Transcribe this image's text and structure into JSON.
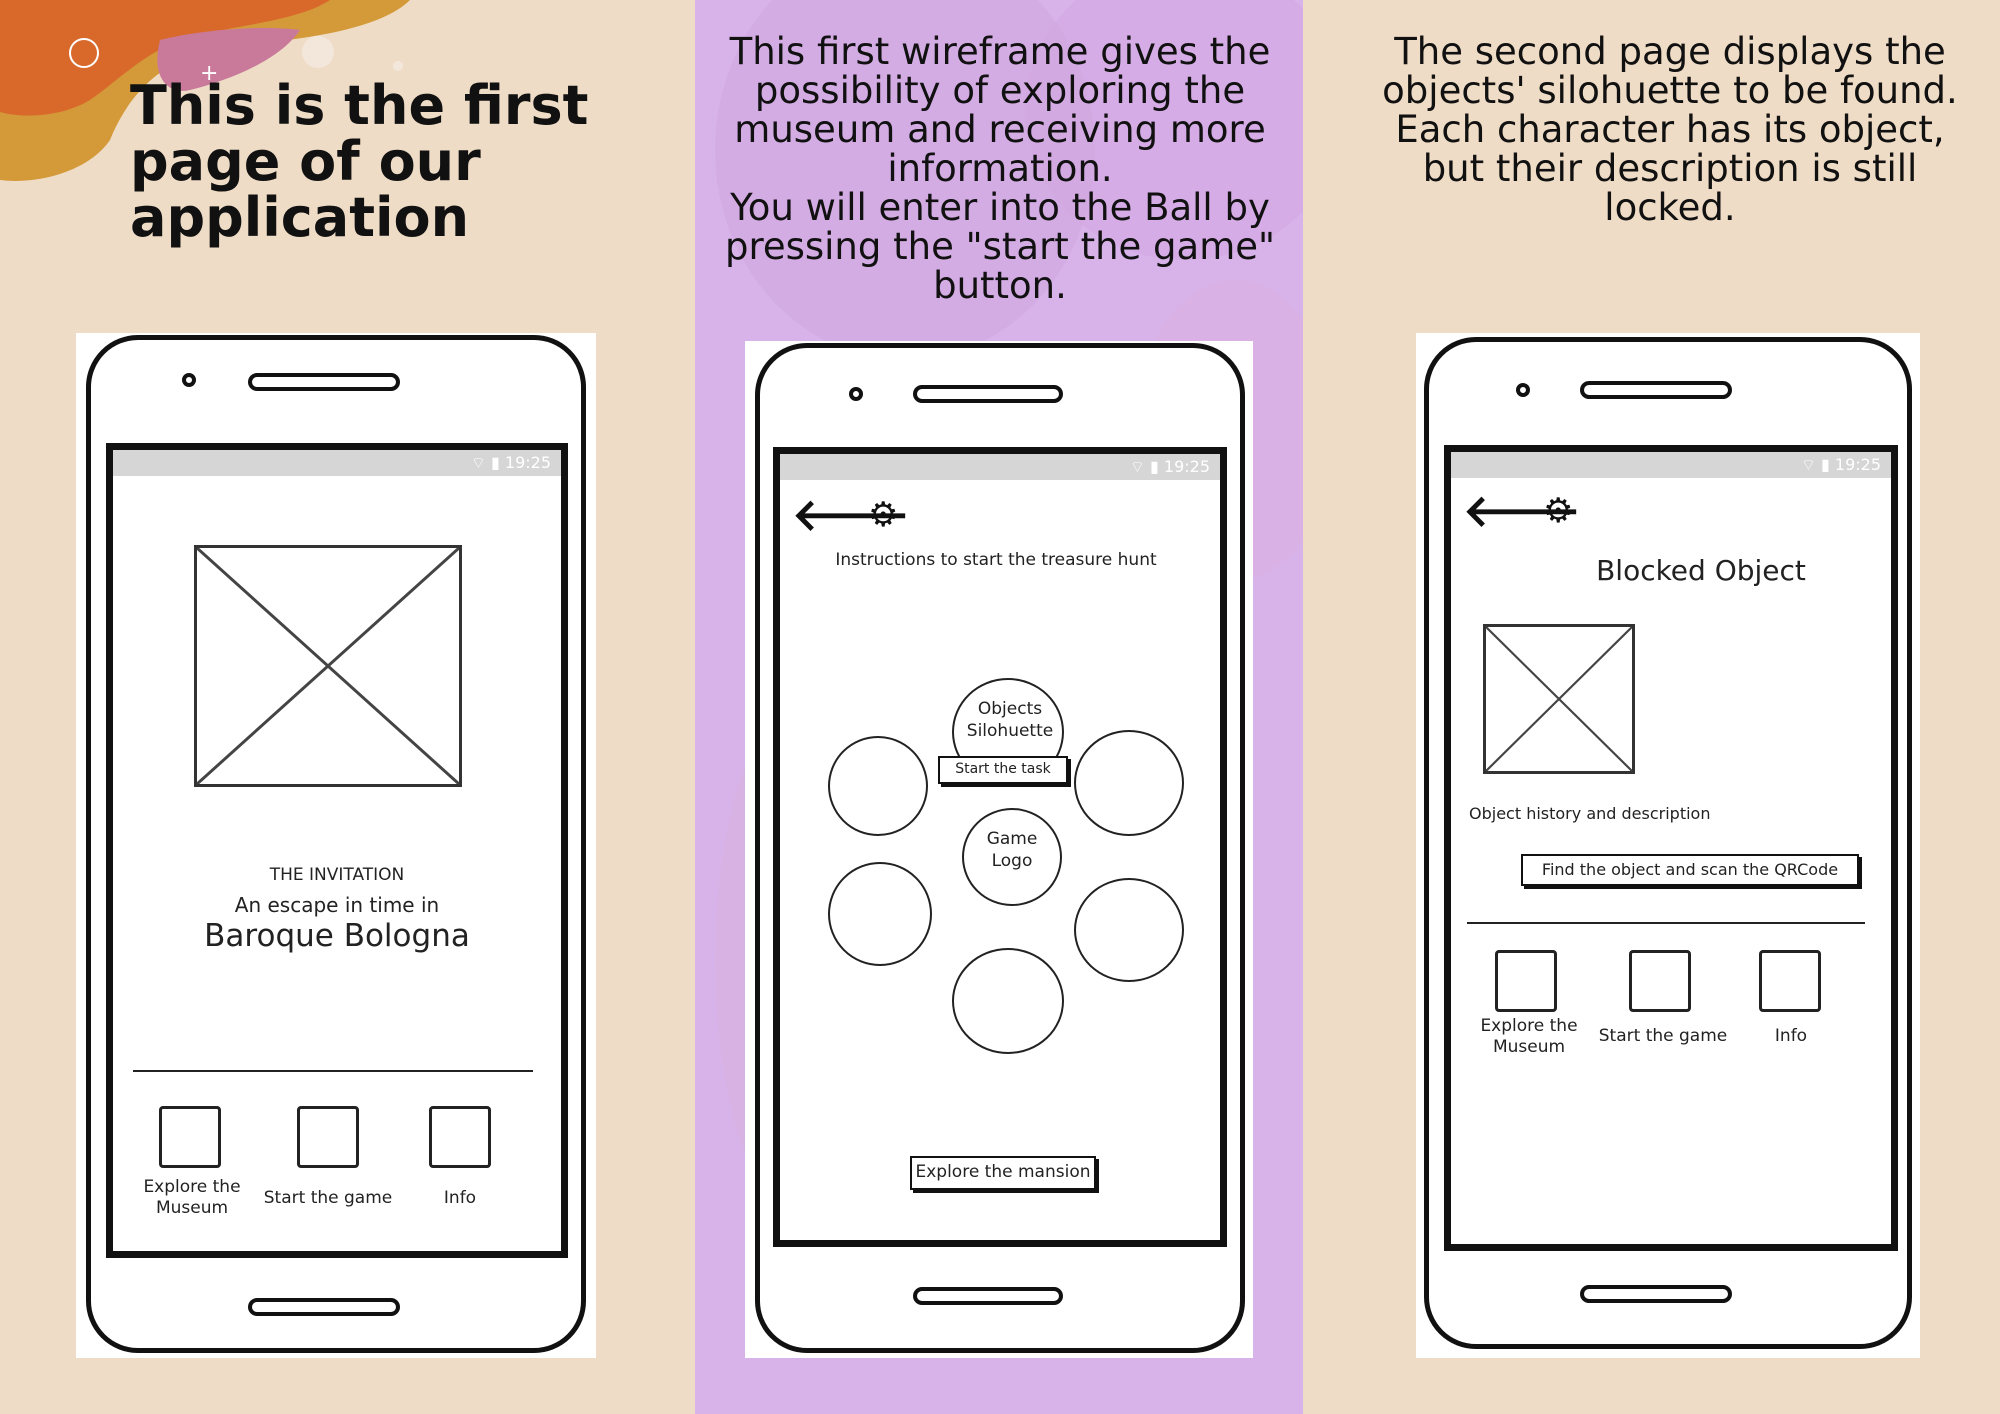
{
  "headline": "This is the first page of our application",
  "descriptions": {
    "middle": "This first wireframe gives the possibility of exploring the museum and receiving more information.\nYou will enter into the Ball by pressing the \"start the game\" button.",
    "right": "The second page displays the objects' silohuette to be found. Each character has its object, but their description is still locked."
  },
  "status_time": "19:25",
  "icons": [
    "back-arrow-icon",
    "gear-icon",
    "wifi-icon",
    "signal-icon",
    "battery-icon",
    "image-placeholder-icon"
  ],
  "phone1": {
    "invitation": "THE INVITATION",
    "subtitle": "An escape in time in",
    "city": "Baroque Bologna",
    "nav": [
      {
        "label": "Explore the\nMuseum"
      },
      {
        "label": "Start the game"
      },
      {
        "label": "Info"
      }
    ]
  },
  "phone2": {
    "instructions": "Instructions to start the treasure hunt",
    "objects_circle": "Objects\nSilohuette",
    "start_task": "Start the task",
    "game_logo": "Game\nLogo",
    "explore_button": "Explore the mansion"
  },
  "phone3": {
    "heading": "Blocked Object",
    "history": "Object history and description",
    "scan_button": "Find the object and scan the QRCode",
    "nav": [
      {
        "label": "Explore the\nMuseum"
      },
      {
        "label": "Start the game"
      },
      {
        "label": "Info"
      }
    ]
  },
  "colors": {
    "background": "#efdcc6",
    "purple_panel": "#d8b3ea",
    "orange": "#d9692a",
    "gold": "#d49a3a",
    "pink": "#c97a9a"
  }
}
